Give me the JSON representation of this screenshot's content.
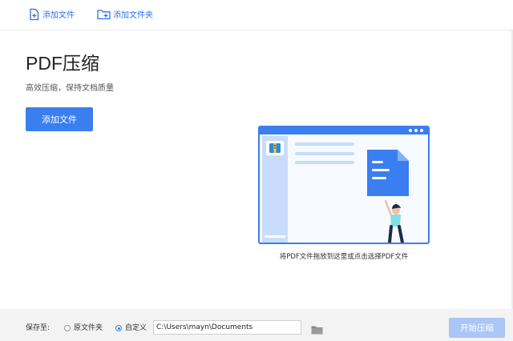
{
  "toolbar": {
    "add_file_label": "添加文件",
    "add_folder_label": "添加文件夹"
  },
  "main": {
    "title": "PDF压缩",
    "subtitle": "高效压缩，保持文档质量",
    "add_file_button": "添加文件"
  },
  "drop_zone": {
    "hint": "将PDF文件拖放到这里或点击选择PDF文件"
  },
  "bottom": {
    "save_to_label": "保存至:",
    "option_original": "原文件夹",
    "option_custom": "自定义",
    "selected_option": "自定义",
    "path_value": "C:\\Users\\mayn\\Documents",
    "start_button": "开始压缩"
  },
  "icons": {
    "add_file": "file-plus-icon",
    "add_folder": "folder-plus-icon",
    "browse_folder": "folder-icon"
  },
  "colors": {
    "accent": "#3a7ef0",
    "toolbar_text": "#2f6fea",
    "start_button_disabled": "#a9c6f7",
    "bottom_bar": "#f3f3f3"
  }
}
